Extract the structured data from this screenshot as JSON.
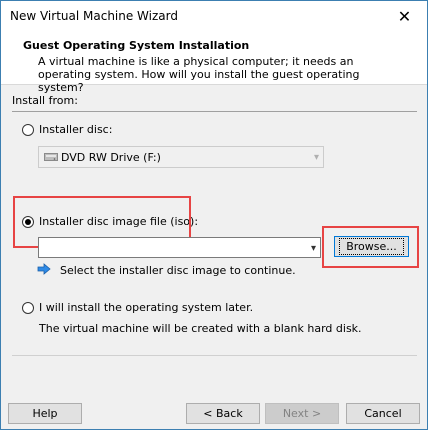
{
  "window": {
    "title": "New Virtual Machine Wizard",
    "close_glyph": "✕"
  },
  "header": {
    "title": "Guest Operating System Installation",
    "description": "A virtual machine is like a physical computer; it needs an operating system. How will you install the guest operating system?"
  },
  "install_from": {
    "label": "Install from:",
    "installer_disc": {
      "label": "Installer disc:",
      "selected": false,
      "drive_value": "DVD RW Drive (F:)"
    },
    "iso": {
      "label": "Installer disc image file (iso):",
      "selected": true,
      "path_value": "",
      "browse_label": "Browse...",
      "hint": "Select the installer disc image to continue."
    },
    "later": {
      "label": "I will install the operating system later.",
      "selected": false,
      "description": "The virtual machine will be created with a blank hard disk."
    }
  },
  "footer": {
    "help_label": "Help",
    "back_label": "< Back",
    "next_label": "Next >",
    "cancel_label": "Cancel"
  },
  "colors": {
    "highlight": "#e74444",
    "accent": "#0078d7"
  }
}
